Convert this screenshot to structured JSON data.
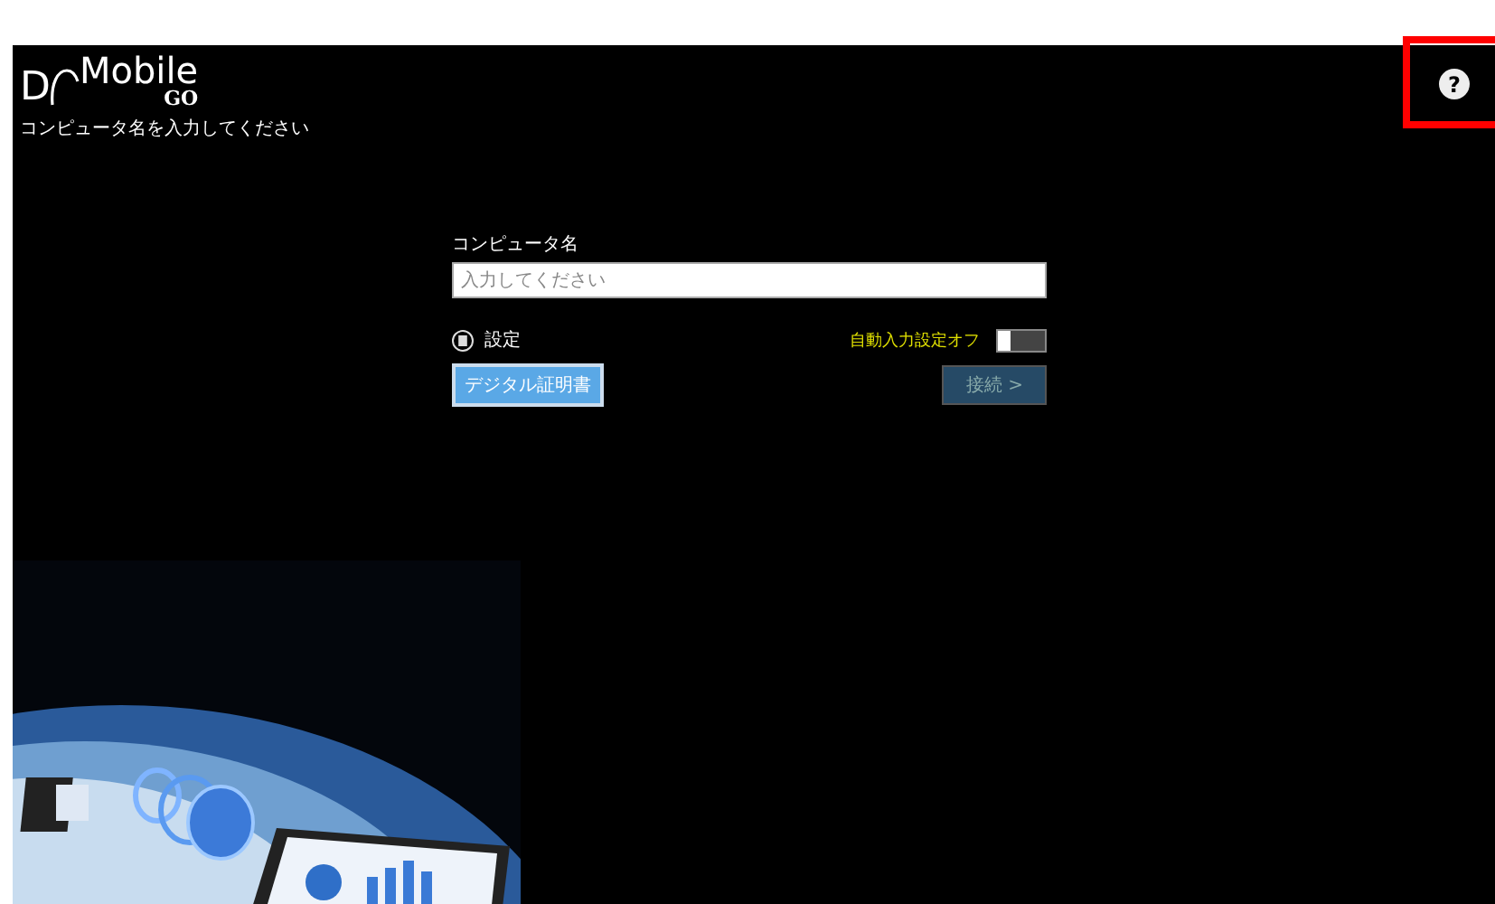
{
  "logo": {
    "letter": "D",
    "word": "Mobile",
    "tag": "GO"
  },
  "subtitle": "コンピュータ名を入力してください",
  "help": {
    "label": "?"
  },
  "form": {
    "label": "コンピュータ名",
    "input": {
      "placeholder": "入力してください"
    },
    "settings": {
      "label": "設定"
    },
    "auto_input": {
      "label": "自動入力設定オフ",
      "on": false
    },
    "cert_button": {
      "label": "デジタル証明書"
    },
    "connect_button": {
      "label": "接続 >",
      "disabled": true
    }
  }
}
